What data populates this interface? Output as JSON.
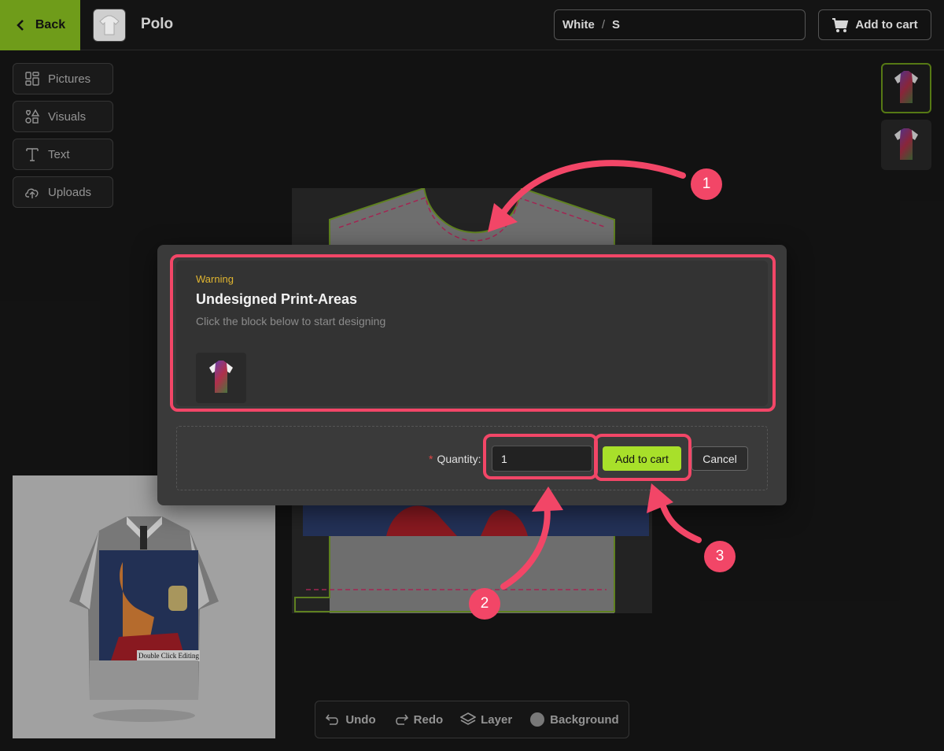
{
  "topbar": {
    "back_label": "Back",
    "product_name": "Polo",
    "variant_color": "White",
    "variant_separator": "/",
    "variant_size": "S",
    "add_to_cart_label": "Add to cart"
  },
  "tools": [
    {
      "label": "Pictures",
      "icon": "grid-icon"
    },
    {
      "label": "Visuals",
      "icon": "shapes-icon"
    },
    {
      "label": "Text",
      "icon": "text-icon"
    },
    {
      "label": "Uploads",
      "icon": "cloud-upload-icon"
    }
  ],
  "preview": {
    "caption_text": "Double Click Editing"
  },
  "bottom_toolbar": {
    "undo_label": "Undo",
    "redo_label": "Redo",
    "layer_label": "Layer",
    "background_label": "Background"
  },
  "modal": {
    "warning_label": "Warning",
    "title": "Undesigned Print-Areas",
    "subtitle": "Click the block below to start designing",
    "quantity_label": "Quantity",
    "quantity_value": "1",
    "add_to_cart_label": "Add to cart",
    "cancel_label": "Cancel"
  },
  "annotations": [
    {
      "number": "1"
    },
    {
      "number": "2"
    },
    {
      "number": "3"
    }
  ],
  "colors": {
    "accent_green": "#6f9c1a",
    "cart_button_green": "#a8e02a",
    "annotation_pink": "#f24667",
    "warning_yellow": "#e0b530"
  }
}
